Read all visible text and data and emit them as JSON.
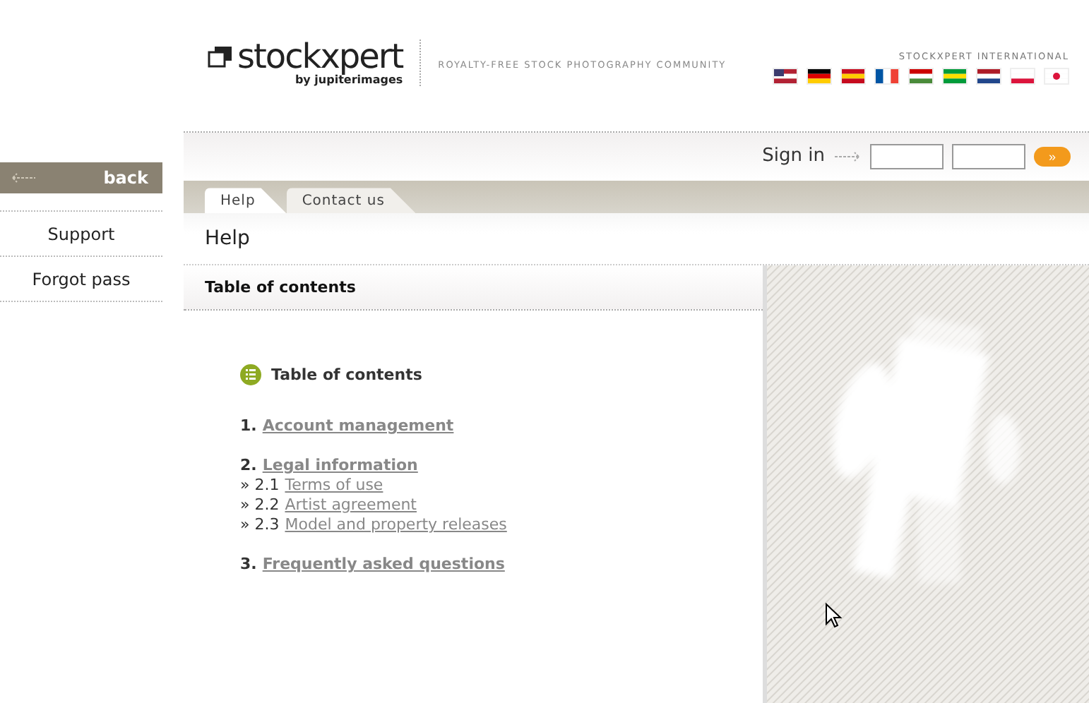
{
  "sidebar": {
    "back": "back",
    "items": [
      {
        "label": "Support"
      },
      {
        "label": "Forgot pass"
      }
    ]
  },
  "header": {
    "logo": "stockxpert",
    "logo_sub": "by jupiterimages",
    "tagline": "ROYALTY-FREE STOCK PHOTOGRAPHY COMMUNITY",
    "international": "STOCKXPERT INTERNATIONAL"
  },
  "signin": {
    "label": "Sign in",
    "go": "»"
  },
  "tabs": [
    {
      "label": "Help",
      "selected": true
    },
    {
      "label": "Contact us",
      "selected": false
    }
  ],
  "page_title": "Help",
  "section_bar": "Table of contents",
  "toc": {
    "title": "Table of contents",
    "sections": [
      {
        "number": "1.",
        "label": "Account management"
      },
      {
        "number": "2.",
        "label": "Legal information",
        "children": [
          {
            "number": "» 2.1",
            "label": "Terms of use"
          },
          {
            "number": "» 2.2",
            "label": "Artist agreement"
          },
          {
            "number": "» 2.3",
            "label": "Model and property releases"
          }
        ]
      },
      {
        "number": "3.",
        "label": "Frequently asked questions"
      }
    ]
  }
}
